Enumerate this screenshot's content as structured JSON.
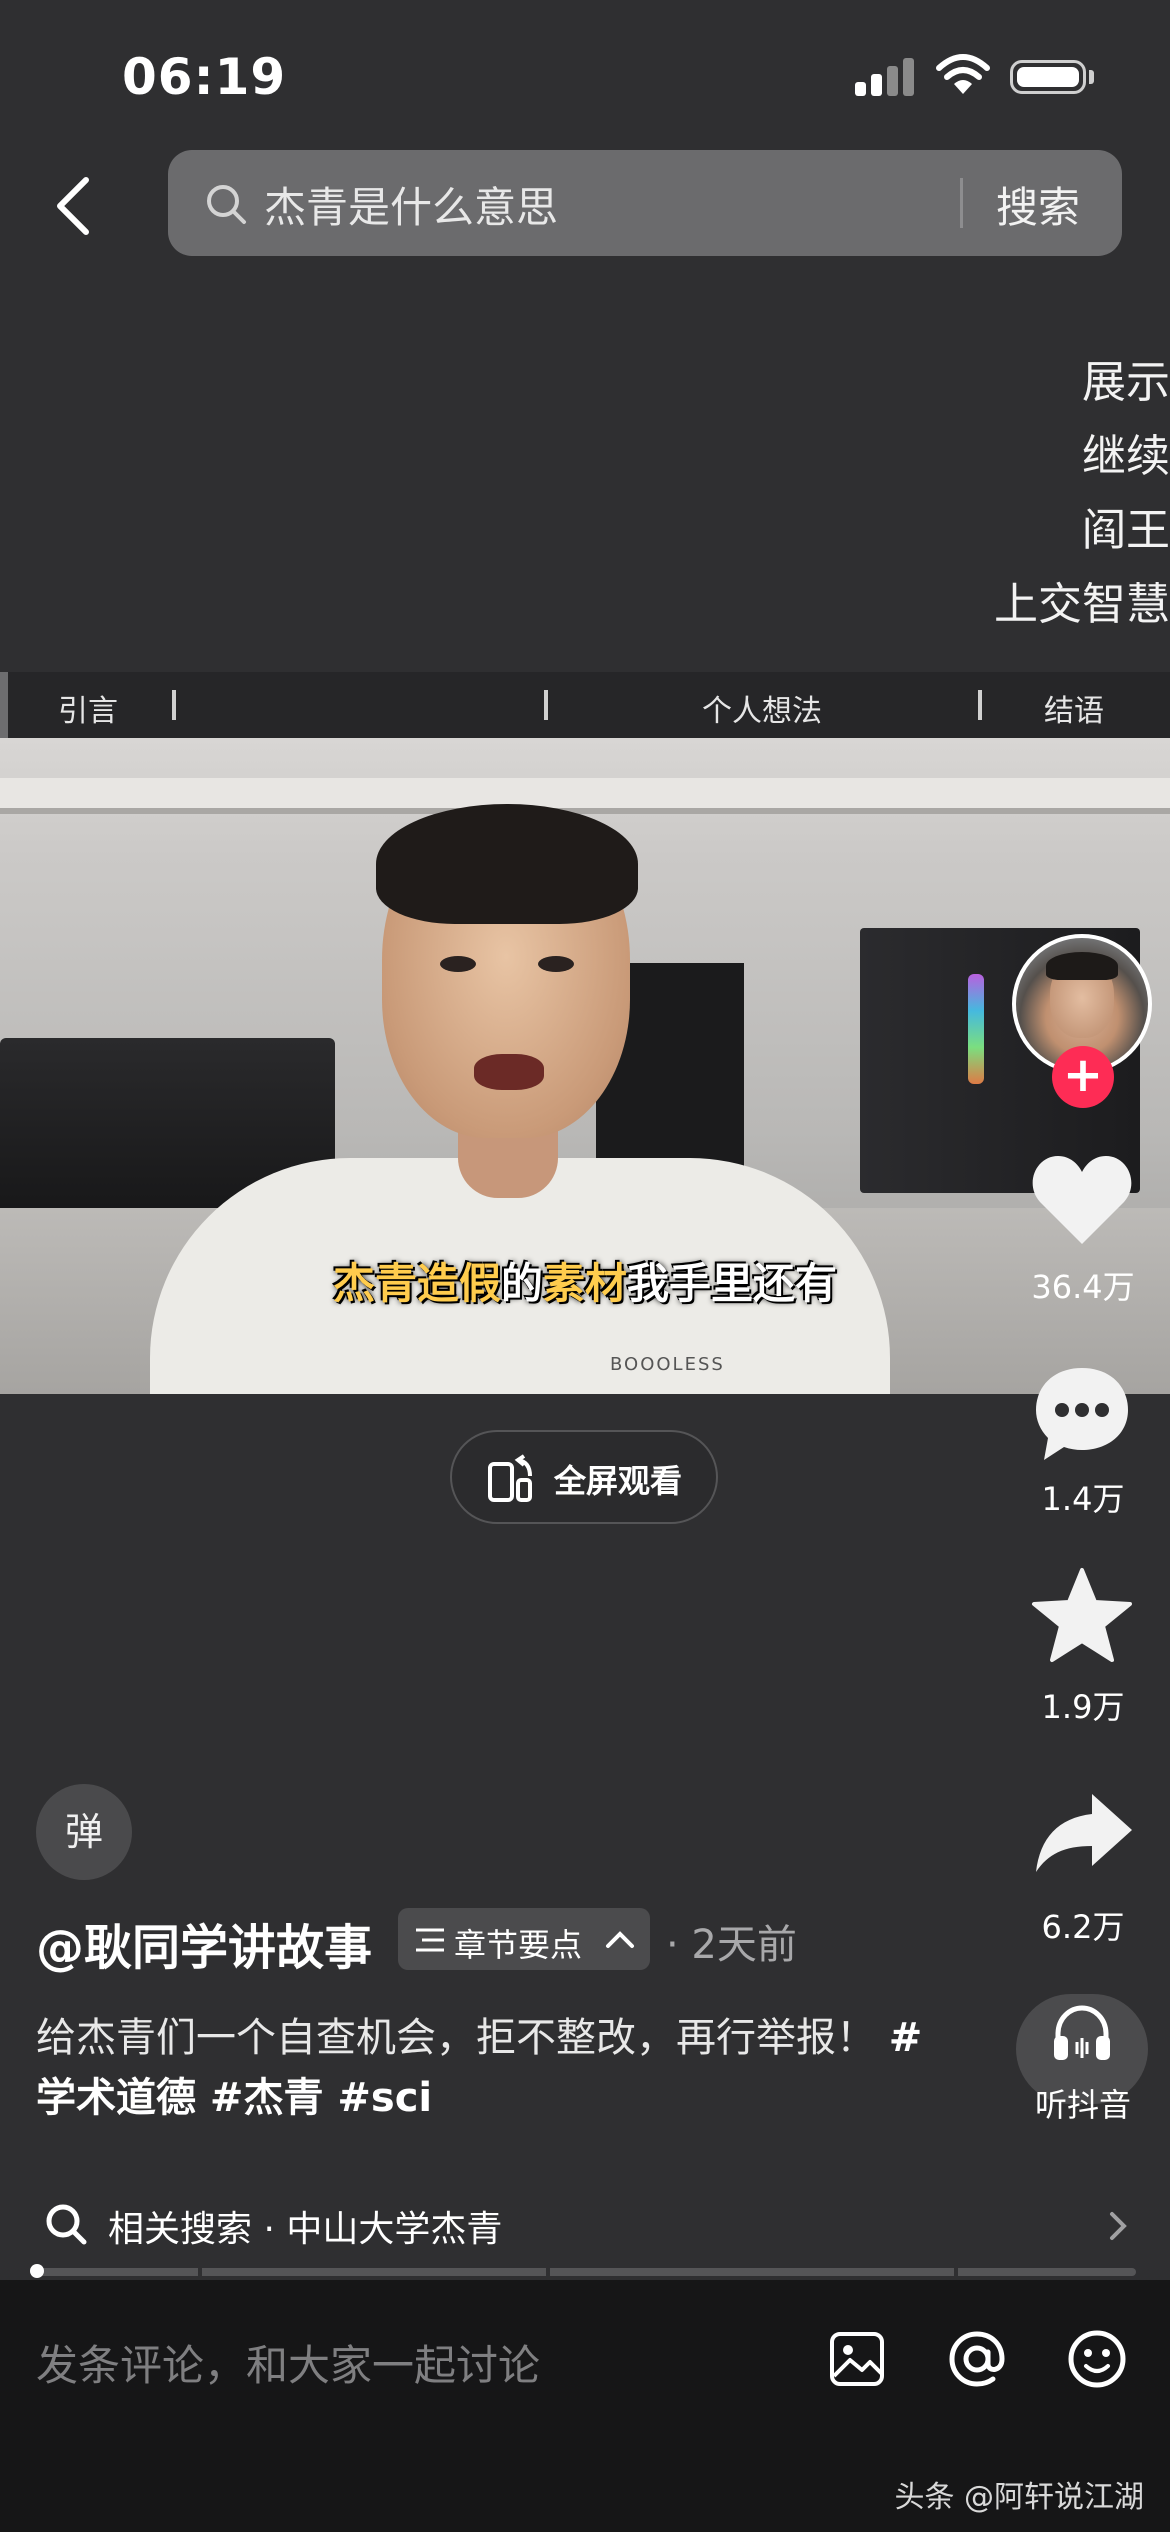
{
  "status_bar": {
    "time": "06:19"
  },
  "search": {
    "query": "杰青是什么意思",
    "button": "搜索"
  },
  "side_text": [
    "展示",
    "继续",
    "阎王",
    "上交智慧"
  ],
  "chapters": [
    "引言",
    "个人想法",
    "结语"
  ],
  "video": {
    "subtitle_part1": "杰青造假",
    "subtitle_part2": "的",
    "subtitle_part3": "素材",
    "subtitle_part4": "我手里还有",
    "shirt_text": "BOOOLESS"
  },
  "fullscreen_label": "全屏观看",
  "rail": {
    "likes": "36.4万",
    "comments": "1.4万",
    "favorites": "1.9万",
    "shares": "6.2万",
    "listen": "听抖音"
  },
  "danmu_label": "弹",
  "author": "@耿同学讲故事",
  "chapter_chip": "章节要点",
  "post_time": "· 2天前",
  "description": "给杰青们一个自查机会，拒不整改，再行举报！",
  "hashtags": "#学术道德 #杰青 #sci",
  "related_search": "相关搜索 · 中山大学杰青",
  "comment_placeholder": "发条评论，和大家一起讨论",
  "watermark": "头条 @阿轩说江湖",
  "colors": {
    "accent": "#fe2c55",
    "subtitle_highlight": "#ffcc4d",
    "background": "#2f2f31"
  }
}
